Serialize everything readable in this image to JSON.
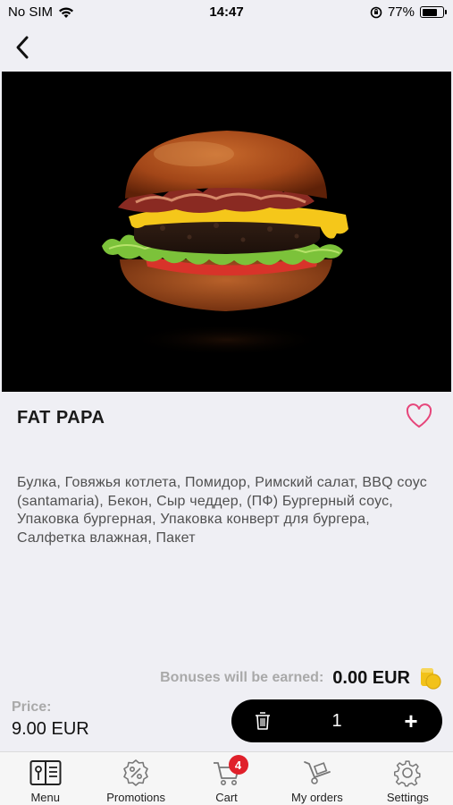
{
  "status": {
    "carrier": "No SIM",
    "time": "14:47",
    "battery": "77%",
    "battery_level": 0.77
  },
  "nav": {
    "back_icon": "chevron-left-icon"
  },
  "product": {
    "name": "FAT PAPA",
    "image": "burger-photo",
    "description": "Булка, Говяжья котлета, Помидор, Римский салат, BBQ соус (santamaria), Бекон, Сыр чеддер, (ПФ) Бургерный соус, Упаковка бургерная, Упаковка конверт для бургера, Салфетка влажная, Пакет",
    "favorite_icon": "heart-outline-icon"
  },
  "bonus": {
    "label": "Bonuses will be earned:",
    "value": "0.00 EUR",
    "icon": "coins-icon"
  },
  "price": {
    "label": "Price:",
    "value": "9.00 EUR"
  },
  "quantity": {
    "value": "1",
    "minus_icon": "trash-icon",
    "plus_label": "+"
  },
  "tabs": [
    {
      "label": "Menu",
      "icon": "menu-book-icon"
    },
    {
      "label": "Promotions",
      "icon": "percent-badge-icon"
    },
    {
      "label": "Cart",
      "icon": "cart-icon",
      "badge": "4"
    },
    {
      "label": "My orders",
      "icon": "hand-truck-icon"
    },
    {
      "label": "Settings",
      "icon": "gear-icon"
    }
  ],
  "colors": {
    "accent_heart": "#e6457a",
    "badge": "#e0202a",
    "bonus_coin": "#f2c21a"
  }
}
